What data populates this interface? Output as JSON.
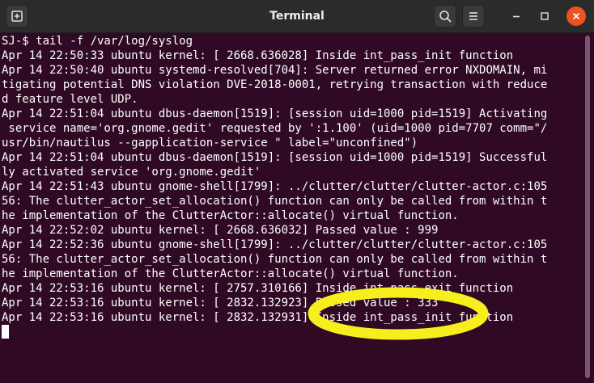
{
  "window": {
    "title": "Terminal"
  },
  "icons": {
    "new_tab": "new-tab-icon",
    "search": "search-icon",
    "menu": "hamburger-menu-icon",
    "minimize": "minimize-icon",
    "maximize": "maximize-icon",
    "close": "close-icon"
  },
  "colors": {
    "terminal_bg": "#300a24",
    "titlebar_bg": "#2b2b2b",
    "text": "#ffffff",
    "close_button": "#e95420",
    "annotation": "#f7ef1d"
  },
  "terminal": {
    "lines": [
      "SJ-$ tail -f /var/log/syslog",
      "Apr 14 22:50:33 ubuntu kernel: [ 2668.636028] Inside int_pass_init function",
      "Apr 14 22:50:40 ubuntu systemd-resolved[704]: Server returned error NXDOMAIN, mi",
      "tigating potential DNS violation DVE-2018-0001, retrying transaction with reduce",
      "d feature level UDP.",
      "Apr 14 22:51:04 ubuntu dbus-daemon[1519]: [session uid=1000 pid=1519] Activating",
      " service name='org.gnome.gedit' requested by ':1.100' (uid=1000 pid=7707 comm=\"/",
      "usr/bin/nautilus --gapplication-service \" label=\"unconfined\")",
      "Apr 14 22:51:04 ubuntu dbus-daemon[1519]: [session uid=1000 pid=1519] Successful",
      "ly activated service 'org.gnome.gedit'",
      "Apr 14 22:51:43 ubuntu gnome-shell[1799]: ../clutter/clutter/clutter-actor.c:105",
      "56: The clutter_actor_set_allocation() function can only be called from within t",
      "he implementation of the ClutterActor::allocate() virtual function.",
      "Apr 14 22:52:02 ubuntu kernel: [ 2668.636032] Passed value : 999",
      "Apr 14 22:52:36 ubuntu gnome-shell[1799]: ../clutter/clutter/clutter-actor.c:105",
      "56: The clutter_actor_set_allocation() function can only be called from within t",
      "he implementation of the ClutterActor::allocate() virtual function.",
      "Apr 14 22:53:16 ubuntu kernel: [ 2757.310166] Inside int_pass_exit function",
      "Apr 14 22:53:16 ubuntu kernel: [ 2832.132923] Passed value : 333",
      "Apr 14 22:53:16 ubuntu kernel: [ 2832.132931] Inside int_pass_init function"
    ]
  }
}
